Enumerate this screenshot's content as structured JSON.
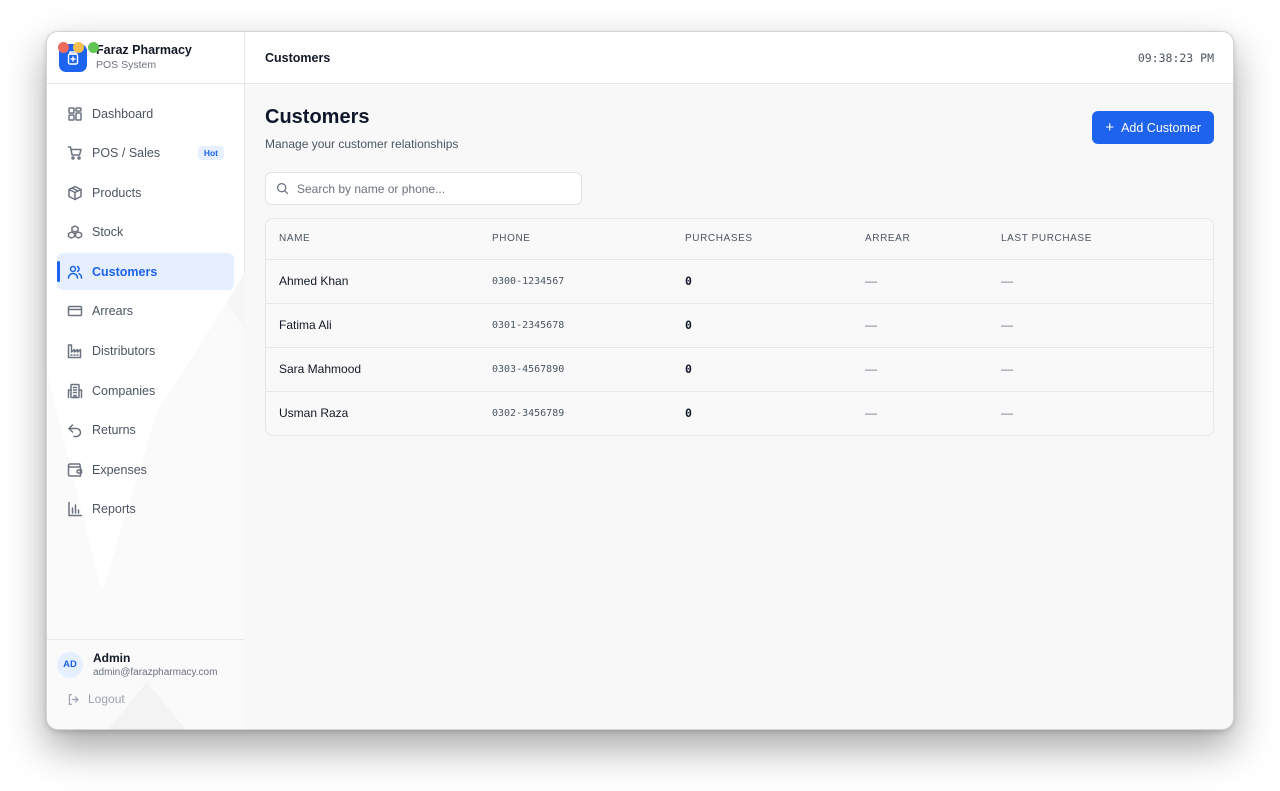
{
  "window": {
    "traffic_lights": [
      "#ee6a5f",
      "#f5bf4f",
      "#61c554"
    ]
  },
  "brand": {
    "name": "Faraz Pharmacy",
    "subtitle": "POS System",
    "accent": "#1d63ed"
  },
  "sidebar": {
    "items": [
      {
        "label": "Dashboard",
        "icon": "dashboard-icon"
      },
      {
        "label": "POS / Sales",
        "icon": "cart-icon",
        "badge": "Hot"
      },
      {
        "label": "Products",
        "icon": "box-icon"
      },
      {
        "label": "Stock",
        "icon": "stock-icon"
      },
      {
        "label": "Customers",
        "icon": "users-icon",
        "active": true
      },
      {
        "label": "Arrears",
        "icon": "card-icon"
      },
      {
        "label": "Distributors",
        "icon": "factory-icon"
      },
      {
        "label": "Companies",
        "icon": "building-icon"
      },
      {
        "label": "Returns",
        "icon": "undo-icon"
      },
      {
        "label": "Expenses",
        "icon": "wallet-icon"
      },
      {
        "label": "Reports",
        "icon": "bar-chart-icon"
      }
    ]
  },
  "user": {
    "initials": "AD",
    "name": "Admin",
    "email": "admin@farazpharmacy.com",
    "logout_label": "Logout"
  },
  "topbar": {
    "title": "Customers",
    "clock": "09:38:23 PM"
  },
  "page": {
    "title": "Customers",
    "subtitle": "Manage your customer relationships",
    "add_button": "Add Customer",
    "search_placeholder": "Search by name or phone..."
  },
  "table": {
    "columns": [
      "NAME",
      "PHONE",
      "PURCHASES",
      "ARREAR",
      "LAST PURCHASE"
    ],
    "rows": [
      {
        "name": "Ahmed Khan",
        "phone": "0300-1234567",
        "purchases": "0",
        "arrear": "—",
        "last_purchase": "—"
      },
      {
        "name": "Fatima Ali",
        "phone": "0301-2345678",
        "purchases": "0",
        "arrear": "—",
        "last_purchase": "—"
      },
      {
        "name": "Sara Mahmood",
        "phone": "0303-4567890",
        "purchases": "0",
        "arrear": "—",
        "last_purchase": "—"
      },
      {
        "name": "Usman Raza",
        "phone": "0302-3456789",
        "purchases": "0",
        "arrear": "—",
        "last_purchase": "—"
      }
    ]
  }
}
